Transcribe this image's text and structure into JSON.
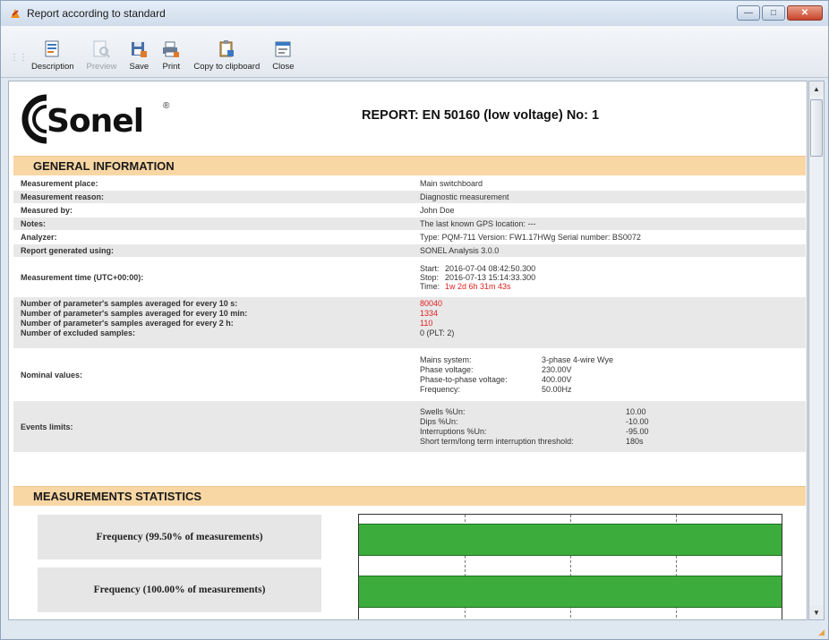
{
  "window": {
    "title": "Report according to standard",
    "controls": {
      "minimize": "—",
      "maximize": "□",
      "close": "✕"
    }
  },
  "toolbar": {
    "items": [
      {
        "label": "Description",
        "icon": "description-icon",
        "enabled": true
      },
      {
        "label": "Preview",
        "icon": "preview-icon",
        "enabled": false
      },
      {
        "label": "Save",
        "icon": "save-icon",
        "enabled": true
      },
      {
        "label": "Print",
        "icon": "print-icon",
        "enabled": true
      },
      {
        "label": "Copy to clipboard",
        "icon": "copy-clipboard-icon",
        "enabled": true
      },
      {
        "label": "Close",
        "icon": "close-report-icon",
        "enabled": true
      }
    ]
  },
  "report": {
    "logo_text": "Sonel",
    "logo_mark": "®",
    "title": "REPORT: EN 50160 (low voltage) No: 1"
  },
  "general": {
    "heading": "GENERAL INFORMATION",
    "measurement_place": {
      "label": "Measurement place:",
      "value": "Main switchboard"
    },
    "measurement_reason": {
      "label": "Measurement reason:",
      "value": "Diagnostic measurement"
    },
    "measured_by": {
      "label": "Measured by:",
      "value": "John Doe"
    },
    "notes": {
      "label": "Notes:",
      "value": "The last known GPS location: ---"
    },
    "analyzer": {
      "label": "Analyzer:",
      "value": "Type: PQM-711 Version: FW1.17HWg Serial number: BS0072"
    },
    "generated_using": {
      "label": "Report generated using:",
      "value": "SONEL Analysis 3.0.0"
    },
    "measurement_time": {
      "label": "Measurement time (UTC+00:00):",
      "start_k": "Start:",
      "start_v": "2016-07-04 08:42:50.300",
      "stop_k": "Stop:",
      "stop_v": "2016-07-13 15:14:33.300",
      "time_k": "Time:",
      "time_v": "1w 2d 6h 31m 43s"
    },
    "samples": {
      "l1": "Number of parameter's samples averaged for every 10 s:",
      "l2": "Number of parameter's samples averaged for every 10 min:",
      "l3": "Number of parameter's samples averaged for every 2 h:",
      "l4": "Number of excluded samples:",
      "v1": "80040",
      "v2": "1334",
      "v3": "110",
      "v4": "0 (PLT: 2)"
    },
    "nominal": {
      "label": "Nominal values:",
      "mains_k": "Mains system:",
      "mains_v": "3-phase 4-wire Wye",
      "phase_k": "Phase voltage:",
      "phase_v": "230.00V",
      "p2p_k": "Phase-to-phase voltage:",
      "p2p_v": "400.00V",
      "freq_k": "Frequency:",
      "freq_v": "50.00Hz"
    },
    "events": {
      "label": "Events limits:",
      "swells_k": "Swells %Un:",
      "swells_v": "10.00",
      "dips_k": "Dips %Un:",
      "dips_v": "-10.00",
      "interr_k": "Interruptions %Un:",
      "interr_v": "-95.00",
      "flicker_k": "Short term/long term interruption threshold:",
      "flicker_v": "180s"
    }
  },
  "stats": {
    "heading": "MEASUREMENTS STATISTICS",
    "rows": [
      {
        "label": "Frequency (99.50% of measurements)",
        "fill": 1.0
      },
      {
        "label": "Frequency (100.00% of measurements)",
        "fill": 1.0
      }
    ]
  },
  "colors": {
    "section_bar": "#f8d7a5",
    "bar_green": "#3cad3c",
    "highlight_red": "#e02020"
  }
}
